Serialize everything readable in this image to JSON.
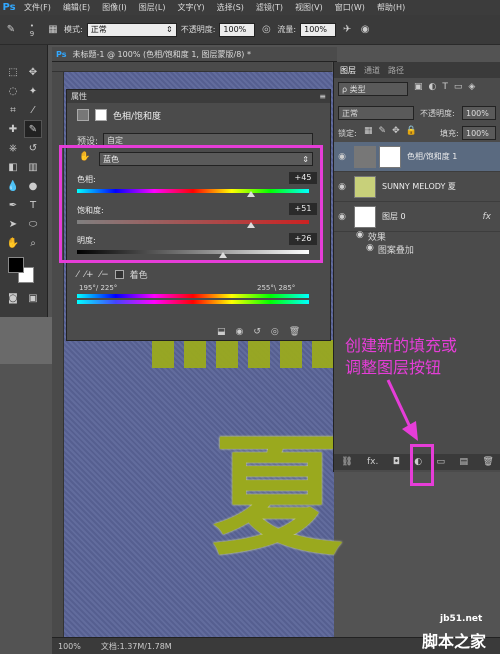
{
  "app": {
    "logo": "Ps"
  },
  "menu": [
    "文件(F)",
    "编辑(E)",
    "图像(I)",
    "图层(L)",
    "文字(Y)",
    "选择(S)",
    "滤镜(T)",
    "视图(V)",
    "窗口(W)",
    "帮助(H)"
  ],
  "options": {
    "brush_size": "9",
    "mode_label": "模式:",
    "mode_value": "正常",
    "opacity_label": "不透明度:",
    "opacity_value": "100%",
    "flow_label": "流量:",
    "flow_value": "100%"
  },
  "document": {
    "tab_title": "未标题-1 @ 100% (色相/饱和度 1, 图层蒙版/8) *",
    "status_zoom": "100%",
    "status_doc": "文档:1.37M/1.78M",
    "canvas_char": "夏"
  },
  "properties": {
    "title": "属性",
    "header": "色相/饱和度",
    "preset_label": "预设:",
    "preset_value": "自定",
    "channel_value": "蓝色",
    "hue_label": "色相:",
    "hue_value": "+45",
    "hue_level": 0.75,
    "sat_label": "饱和度:",
    "sat_value": "+51",
    "sat_level": 0.75,
    "light_label": "明度:",
    "light_value": "+26",
    "light_level": 0.63,
    "colorize_label": "着色",
    "range_left": "195°/ 225°",
    "range_right": "255°\\ 285°"
  },
  "layers": {
    "tabs": [
      "图层",
      "通道",
      "路径"
    ],
    "kind_label": "ρ 类型",
    "blend_value": "正常",
    "opacity_label": "不透明度:",
    "opacity_value": "100%",
    "lock_label": "锁定:",
    "fill_label": "填充:",
    "fill_value": "100%",
    "items": [
      {
        "name": "色相/饱和度 1"
      },
      {
        "name": "SUNNY MELODY 夏"
      },
      {
        "name": "图层 0",
        "fx": "fx"
      }
    ],
    "effects_label": "效果",
    "effect_item": "图案叠加"
  },
  "annotation": {
    "line1": "创建新的填充或",
    "line2": "调整图层按钮"
  },
  "watermark": {
    "site": "jb51.net",
    "name": "脚本之家"
  }
}
